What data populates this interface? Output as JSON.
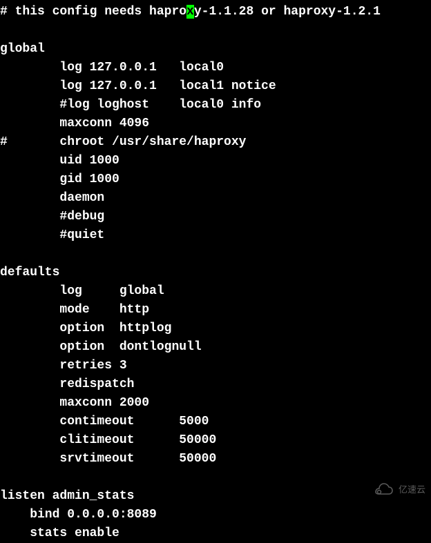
{
  "terminal": {
    "lines": [
      {
        "pre": "# this config needs hapro",
        "cursor": "x",
        "post": "y-1.1.28 or haproxy-1.2.1"
      },
      {
        "pre": "",
        "cursor": "",
        "post": ""
      },
      {
        "pre": "global",
        "cursor": "",
        "post": ""
      },
      {
        "pre": "        log 127.0.0.1   local0",
        "cursor": "",
        "post": ""
      },
      {
        "pre": "        log 127.0.0.1   local1 notice",
        "cursor": "",
        "post": ""
      },
      {
        "pre": "        #log loghost    local0 info",
        "cursor": "",
        "post": ""
      },
      {
        "pre": "        maxconn 4096",
        "cursor": "",
        "post": ""
      },
      {
        "pre": "#       chroot /usr/share/haproxy",
        "cursor": "",
        "post": ""
      },
      {
        "pre": "        uid 1000",
        "cursor": "",
        "post": ""
      },
      {
        "pre": "        gid 1000",
        "cursor": "",
        "post": ""
      },
      {
        "pre": "        daemon",
        "cursor": "",
        "post": ""
      },
      {
        "pre": "        #debug",
        "cursor": "",
        "post": ""
      },
      {
        "pre": "        #quiet",
        "cursor": "",
        "post": ""
      },
      {
        "pre": "",
        "cursor": "",
        "post": ""
      },
      {
        "pre": "defaults",
        "cursor": "",
        "post": ""
      },
      {
        "pre": "        log     global",
        "cursor": "",
        "post": ""
      },
      {
        "pre": "        mode    http",
        "cursor": "",
        "post": ""
      },
      {
        "pre": "        option  httplog",
        "cursor": "",
        "post": ""
      },
      {
        "pre": "        option  dontlognull",
        "cursor": "",
        "post": ""
      },
      {
        "pre": "        retries 3",
        "cursor": "",
        "post": ""
      },
      {
        "pre": "        redispatch",
        "cursor": "",
        "post": ""
      },
      {
        "pre": "        maxconn 2000",
        "cursor": "",
        "post": ""
      },
      {
        "pre": "        contimeout      5000",
        "cursor": "",
        "post": ""
      },
      {
        "pre": "        clitimeout      50000",
        "cursor": "",
        "post": ""
      },
      {
        "pre": "        srvtimeout      50000",
        "cursor": "",
        "post": ""
      },
      {
        "pre": "",
        "cursor": "",
        "post": ""
      },
      {
        "pre": "listen admin_stats",
        "cursor": "",
        "post": ""
      },
      {
        "pre": "    bind 0.0.0.0:8089",
        "cursor": "",
        "post": ""
      },
      {
        "pre": "    stats enable",
        "cursor": "",
        "post": ""
      }
    ]
  },
  "watermark": {
    "text": "亿速云"
  }
}
